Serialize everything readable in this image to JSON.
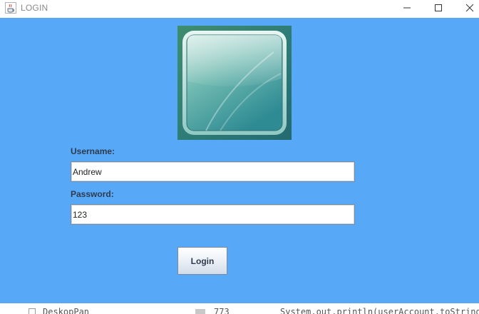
{
  "window": {
    "title": "LOGIN",
    "icon": "java-coffee-cup-icon",
    "controls": {
      "minimize": "minimize-icon",
      "maximize": "maximize-icon",
      "close": "close-icon"
    }
  },
  "colors": {
    "panel_background": "#58a8f8",
    "label_text": "#2e3b4e",
    "titlebar_text": "#8a8a8a"
  },
  "logo": {
    "icon": "glossy-teal-square-logo"
  },
  "form": {
    "username_label": "Username:",
    "username_value": "Andrew",
    "password_label": "Password:",
    "password_value": "123",
    "login_label": "Login"
  },
  "background_window": {
    "text_left": "DeskopPan",
    "text_mid": "773",
    "text_right": "System.out.println(userAccount.toString("
  }
}
